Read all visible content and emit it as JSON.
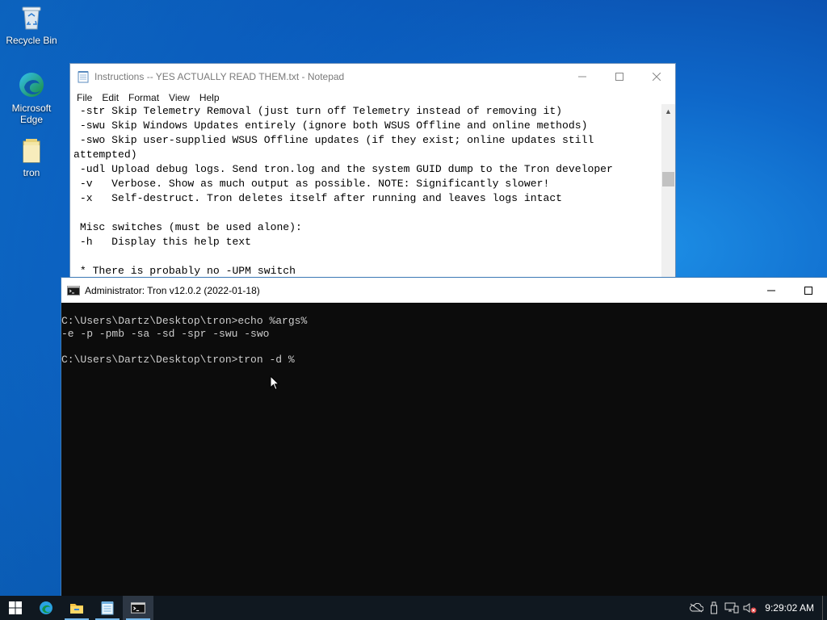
{
  "desktop": {
    "icons": [
      {
        "label": "Recycle Bin"
      },
      {
        "label": "Microsoft Edge"
      },
      {
        "label": "tron"
      }
    ]
  },
  "notepad": {
    "title": "Instructions -- YES ACTUALLY READ THEM.txt - Notepad",
    "menu": [
      "File",
      "Edit",
      "Format",
      "View",
      "Help"
    ],
    "lines": [
      " -str Skip Telemetry Removal (just turn off Telemetry instead of removing it)",
      " -swu Skip Windows Updates entirely (ignore both WSUS Offline and online methods)",
      " -swo Skip user-supplied WSUS Offline updates (if they exist; online updates still",
      "attempted)",
      " -udl Upload debug logs. Send tron.log and the system GUID dump to the Tron developer",
      " -v   Verbose. Show as much output as possible. NOTE: Significantly slower!",
      " -x   Self-destruct. Tron deletes itself after running and leaves logs intact",
      "",
      " Misc switches (must be used alone):",
      " -h   Display this help text",
      "",
      " * There is probably no -UPM switch"
    ]
  },
  "cmd": {
    "title": "Administrator:  Tron v12.0.2 (2022-01-18)",
    "lines": [
      "C:\\Users\\Dartz\\Desktop\\tron>echo %args%",
      "-e -p -pmb -sa -sd -spr -swu -swo",
      "",
      "C:\\Users\\Dartz\\Desktop\\tron>tron -d %"
    ]
  },
  "taskbar": {
    "items": [
      "start-button",
      "edge",
      "file-explorer",
      "notepad",
      "command-prompt"
    ],
    "active": "command-prompt",
    "clock": "9:29:02 AM"
  },
  "colors": {
    "taskbar": "#101820",
    "console_bg": "#0c0c0c",
    "console_text": "#cccccc",
    "accent": "#76b9ed"
  }
}
